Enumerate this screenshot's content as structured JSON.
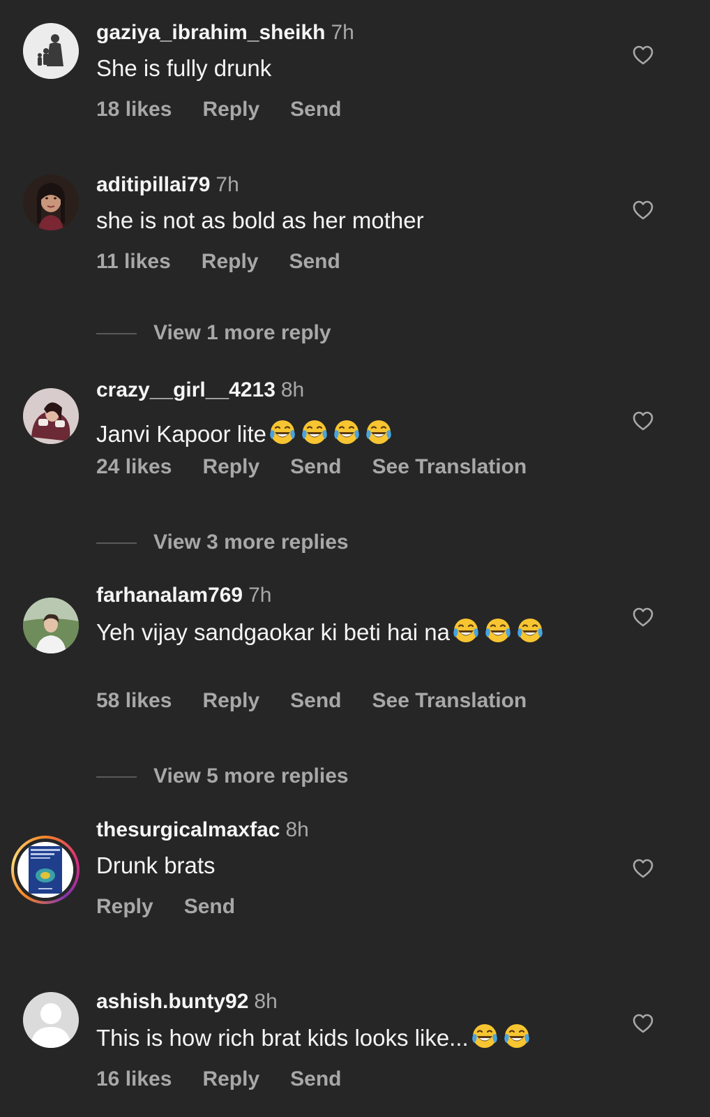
{
  "comments": [
    {
      "username": "gaziya_ibrahim_sheikh",
      "time": "7h",
      "text": "She is fully drunk",
      "emoji_count": 0,
      "likes": "18 likes",
      "reply": "Reply",
      "send": "Send",
      "avatar": "silhouette-family-avatar"
    },
    {
      "username": "aditipillai79",
      "time": "7h",
      "text": "she is not as bold as her mother",
      "emoji_count": 0,
      "likes": "11 likes",
      "reply": "Reply",
      "send": "Send",
      "avatar": "woman-portrait-avatar",
      "view_more": "View 1 more reply"
    },
    {
      "username": "crazy__girl__4213",
      "time": "8h",
      "text": "Janvi Kapoor lite",
      "emoji_count": 4,
      "likes": "24 likes",
      "reply": "Reply",
      "send": "Send",
      "see_translation": "See Translation",
      "avatar": "girl-photo-avatar",
      "view_more": "View 3 more replies"
    },
    {
      "username": "farhanalam769",
      "time": "7h",
      "text": "Yeh vijay sandgaokar ki beti hai na",
      "emoji_count": 3,
      "likes": "58 likes",
      "reply": "Reply",
      "send": "Send",
      "see_translation": "See Translation",
      "avatar": "man-outdoor-avatar",
      "view_more": "View 5 more replies"
    },
    {
      "username": "thesurgicalmaxfac",
      "time": "8h",
      "text": "Drunk brats",
      "emoji_count": 0,
      "reply": "Reply",
      "send": "Send",
      "avatar": "book-cover-avatar"
    },
    {
      "username": "ashish.bunty92",
      "time": "8h",
      "text": "This is how rich brat kids looks like...",
      "emoji_count": 2,
      "likes": "16 likes",
      "reply": "Reply",
      "send": "Send",
      "avatar": "default-user-avatar"
    }
  ],
  "emoji": "face-with-tears-of-joy",
  "colors": {
    "background": "#262626",
    "primary_text": "#f5f5f5",
    "secondary_text": "#a8a8a8",
    "emoji_yellow": "#f7c531",
    "tear_blue": "#4aa3df"
  }
}
